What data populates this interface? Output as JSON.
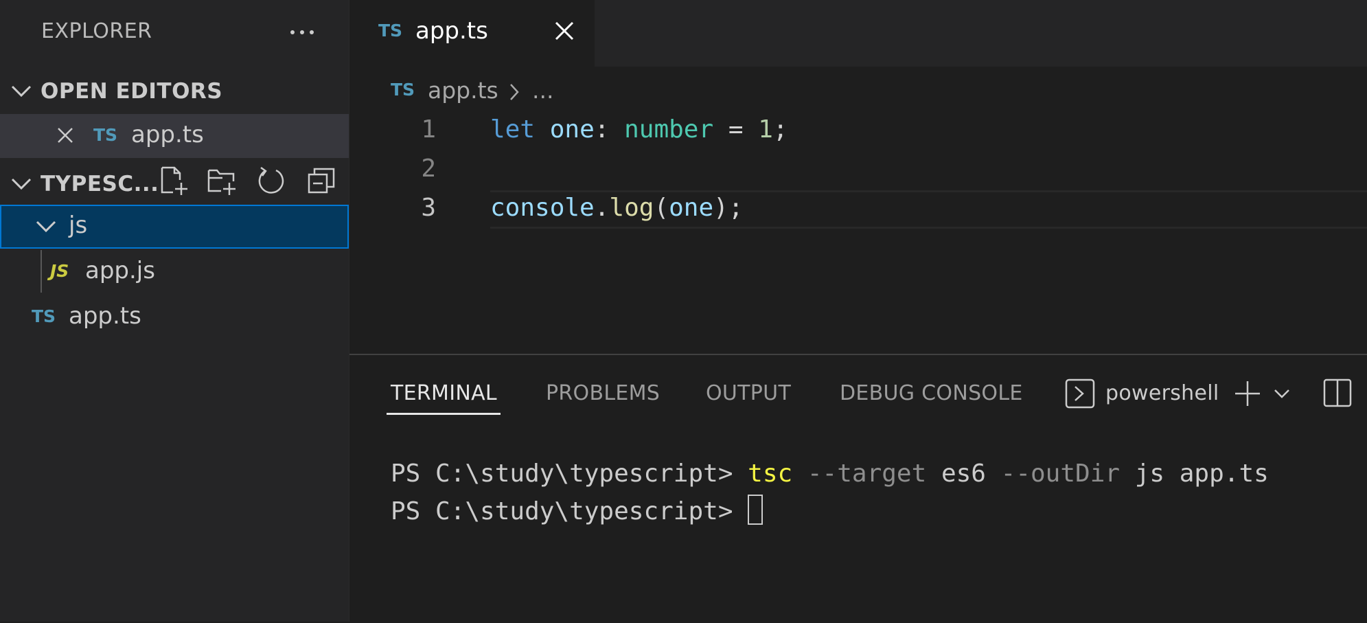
{
  "sidebar": {
    "title": "EXPLORER",
    "open_editors": {
      "title": "OPEN EDITORS",
      "items": [
        {
          "badge": "TS",
          "label": "app.ts"
        }
      ]
    },
    "project": {
      "title": "TYPESC...",
      "toolbar_icons": [
        "new-file-icon",
        "new-folder-icon",
        "refresh-icon",
        "collapse-all-icon"
      ],
      "tree": [
        {
          "type": "folder",
          "label": "js",
          "expanded": true
        },
        {
          "type": "file",
          "badge": "JS",
          "label": "app.js"
        },
        {
          "type": "file",
          "badge": "TS",
          "label": "app.ts"
        }
      ]
    }
  },
  "editor": {
    "tab": {
      "badge": "TS",
      "label": "app.ts"
    },
    "breadcrumb": {
      "badge": "TS",
      "label": "app.ts",
      "ellipsis": "..."
    },
    "line_numbers": [
      "1",
      "2",
      "3"
    ],
    "lines": {
      "l1": {
        "kw": "let",
        "var": "one",
        "colon": ": ",
        "type": "number",
        "eq": " = ",
        "num": "1",
        "semi": ";"
      },
      "l3": {
        "obj": "console",
        "dot": ".",
        "fn": "log",
        "open": "(",
        "arg": "one",
        "close": ");"
      }
    }
  },
  "panel": {
    "tabs": [
      "TERMINAL",
      "PROBLEMS",
      "OUTPUT",
      "DEBUG CONSOLE"
    ],
    "active_tab": "TERMINAL",
    "shell_name": "powershell",
    "terminal": {
      "line1": {
        "prompt": "PS C:\\study\\typescript> ",
        "cmd": "tsc",
        "flag1": " --target",
        "arg1": " es6",
        "flag2": " --outDir",
        "arg2": " js app.ts"
      },
      "line2": {
        "prompt": "PS C:\\study\\typescript> "
      }
    }
  },
  "colors": {
    "accent": "#0078d4",
    "ts_badge": "#519aba",
    "js_badge": "#cbcb41",
    "selection": "#04395e"
  }
}
